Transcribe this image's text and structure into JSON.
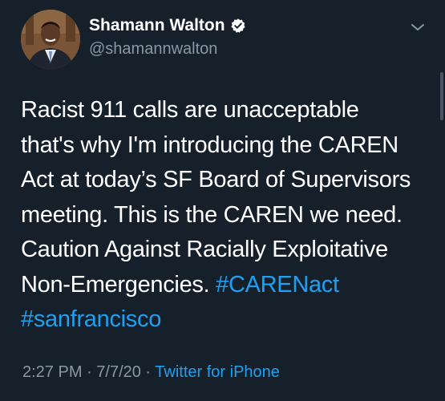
{
  "tweet": {
    "author": {
      "display_name": "Shamann Walton",
      "handle": "@shamannwalton",
      "verified": true
    },
    "text_lines": [
      "Racist 911 calls are unacceptable",
      "that's why I'm introducing the CAREN",
      "Act at today’s SF Board of Supervisors",
      "meeting. This is the CAREN we need.",
      "Caution Against Racially Exploitative"
    ],
    "last_line_text": "Non-Emergencies. ",
    "hashtags": [
      "#CARENact",
      "#sanfrancisco"
    ],
    "time": "2:27 PM",
    "separator_1": " · ",
    "date": "7/7/20",
    "separator_2": " · ",
    "source": "Twitter for iPhone"
  },
  "icons": {
    "verified": "verified-badge-icon",
    "menu": "chevron-down-icon"
  },
  "colors": {
    "background": "#15202b",
    "text": "#ffffff",
    "secondary": "#8899a6",
    "link": "#1da1f2"
  }
}
